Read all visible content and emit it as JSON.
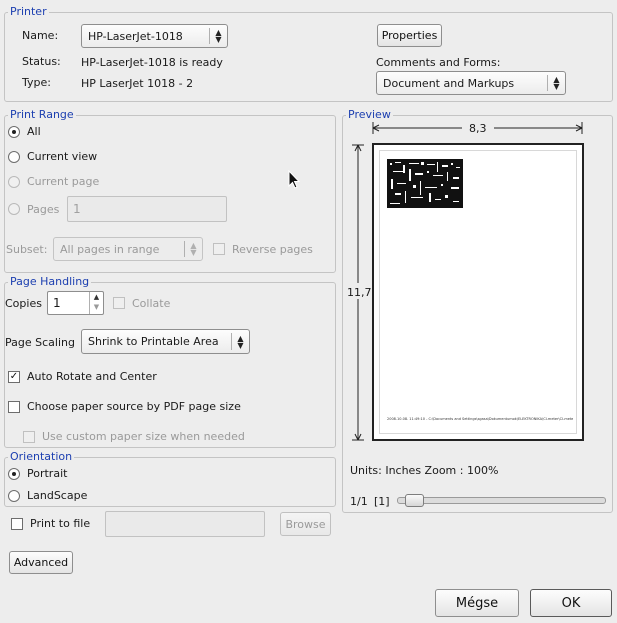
{
  "printer": {
    "legend": "Printer",
    "name_label": "Name:",
    "name_value": "HP-LaserJet-1018",
    "status_label": "Status:",
    "status_value": "HP-LaserJet-1018 is ready",
    "type_label": "Type:",
    "type_value": "HP LaserJet 1018 -  2",
    "properties_button": "Properties",
    "comments_label": "Comments and Forms:",
    "comments_value": "Document and Markups"
  },
  "print_range": {
    "legend": "Print Range",
    "all": "All",
    "current_view": "Current view",
    "current_page": "Current page",
    "pages": "Pages",
    "pages_value": "1",
    "subset_label": "Subset:",
    "subset_value": "All pages in range",
    "reverse_pages": "Reverse pages"
  },
  "page_handling": {
    "legend": "Page Handling",
    "copies_label": "Copies",
    "copies_value": "1",
    "collate": "Collate",
    "scaling_label": "Page Scaling",
    "scaling_value": "Shrink to Printable Area",
    "auto_rotate": "Auto Rotate and Center",
    "choose_source": "Choose paper source by PDF page size",
    "custom_size": "Use custom paper size when needed"
  },
  "orientation": {
    "legend": "Orientation",
    "portrait": "Portrait",
    "landscape": "LandScape"
  },
  "print_to_file": {
    "label": "Print to file",
    "browse_button": "Browse"
  },
  "preview": {
    "legend": "Preview",
    "width": "8,3",
    "height": "11,7",
    "footer_text": "2008.10.08. 11:49:10 - C:\\Documents and Settings\\sgasa\\Dokumentumok\\ELEKTRONIKA\\CI-meter\\CI-meter_dgo.rb...",
    "units_zoom": "Units: Inches Zoom : 100%",
    "page_count": "1/1",
    "page_index": "[1]",
    "slider_position": 0.03
  },
  "buttons": {
    "advanced": "Advanced",
    "cancel": "Mégse",
    "ok": "OK"
  }
}
